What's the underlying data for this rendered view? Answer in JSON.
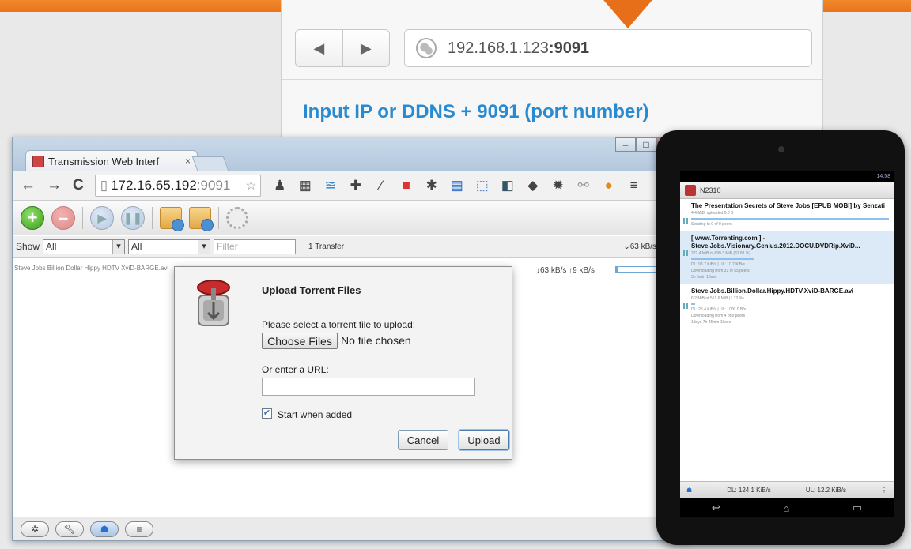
{
  "callout": {
    "url_ip": "192.168.1.123",
    "url_port": ":9091",
    "instruction": "Input IP or DDNS + 9091 (port number)"
  },
  "browser": {
    "tab_title": "Transmission Web Interf",
    "tab_close": "×",
    "url_host": "172.16.65.192",
    "url_port": ":9091",
    "window_buttons": [
      "–",
      "□",
      "x"
    ]
  },
  "transmission": {
    "show_label": "Show",
    "filter_state": "All",
    "filter_tracker": "All",
    "filter_placeholder": "Filter",
    "transfer_count": "1 Transfer",
    "total_speed": "⌄63 kB/s  ⌃9 kB/",
    "row_speed": "↓63 kB/s ↑9 kB/s",
    "row_name": "Steve Jobs Billion Dollar Hippy HDTV XviD-BARGE.avi",
    "row_progress_pct": 4
  },
  "dialog": {
    "title": "Upload Torrent Files",
    "prompt": "Please select a torrent file to upload:",
    "choose_files": "Choose Files",
    "no_file": "No file chosen",
    "url_label": "Or enter a URL:",
    "url_value": "",
    "start_label": "Start when added",
    "start_checked": true,
    "cancel": "Cancel",
    "upload": "Upload"
  },
  "tablet": {
    "app_title": "N2310",
    "status_time": "14:58",
    "torrents": [
      {
        "name": "The Presentation Secrets of Steve Jobs [EPUB MOBI] by Senzati",
        "line1": "4.4 MiB, uploaded 0.0 B",
        "line2": "Sending to 0 of 0 peers",
        "progress": 100
      },
      {
        "name": "[ www.Torrenting.com ] - Steve.Jobs.Visionary.Genius.2012.DOCU.DVDRip.XviD...",
        "line1": "222.4 MiB of 699.3 MiB (31.81 %)",
        "line2": "DL: 96.7 KiB/s | UL: 10.7 KiB/s",
        "line3": "Downloading from 31 of 55 peers",
        "line4": "3h 5min 16sec",
        "progress": 32
      },
      {
        "name": "Steve.Jobs.Billion.Dollar.Hippy.HDTV.XviD-BARGE.avi",
        "line1": "6.2 MiB of 551.6 MiB (1.12 %)",
        "line2": "DL: 25.4 KiB/s | UL: 1000.0 B/s",
        "line3": "Downloading from 4 of 8 peers",
        "line4": "1days 7h 45min 19sec",
        "progress": 1
      }
    ],
    "dl_total": "DL: 124.1 KiB/s",
    "ul_total": "UL: 12.2 KiB/s"
  }
}
